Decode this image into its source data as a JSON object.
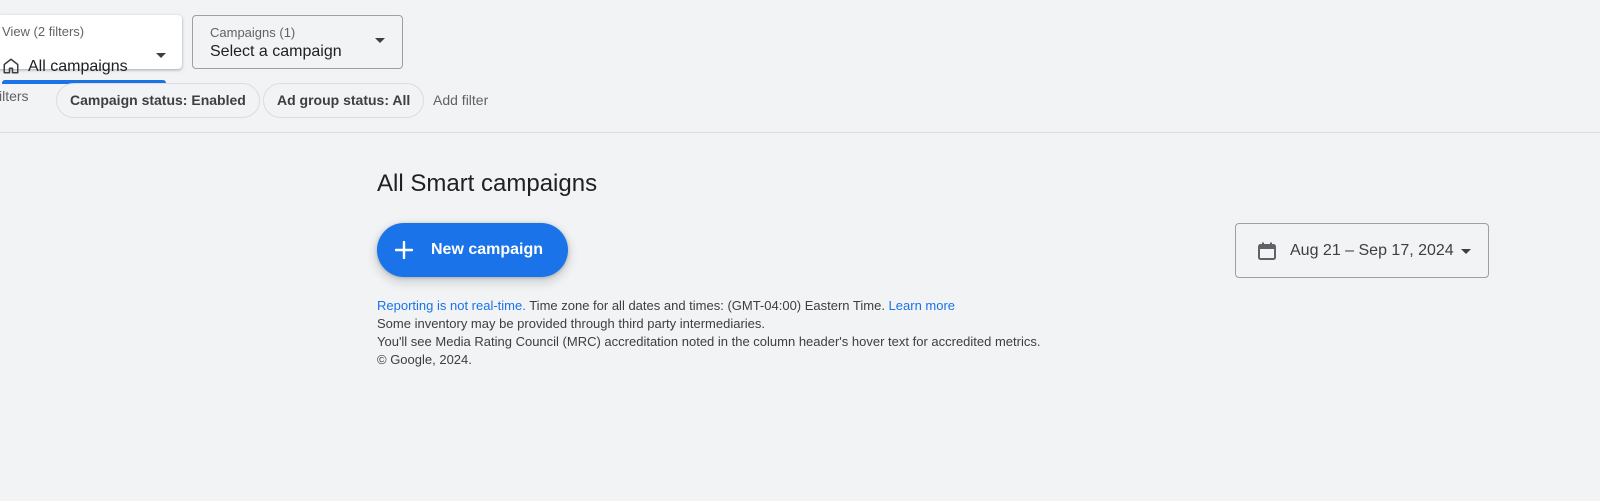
{
  "header": {
    "view_selector": {
      "label": "View (2 filters)",
      "value": "All campaigns",
      "icon": "home-icon"
    },
    "campaign_selector": {
      "label": "Campaigns (1)",
      "value": "Select a campaign"
    }
  },
  "filters": {
    "label": "ilters",
    "chips": [
      {
        "label": "Campaign status: Enabled"
      },
      {
        "label": "Ad group status: All"
      }
    ],
    "add_filter_label": "Add filter"
  },
  "main": {
    "title": "All Smart campaigns",
    "new_campaign_label": "New campaign",
    "date_range": {
      "label": "Aug 21 – Sep 17, 2024",
      "icon": "calendar-icon"
    }
  },
  "footer": {
    "reporting_link": "Reporting is not real-time.",
    "timezone_text": " Time zone for all dates and times: (GMT-04:00) Eastern Time. ",
    "learn_more_link": "Learn more",
    "inventory_text": "Some inventory may be provided through third party intermediaries.",
    "mrc_text": "You'll see Media Rating Council (MRC) accreditation noted in the column header's hover text for accredited metrics.",
    "copyright": "© Google, 2024."
  },
  "colors": {
    "accent": "#1a73e8",
    "background": "#f1f3f4"
  }
}
